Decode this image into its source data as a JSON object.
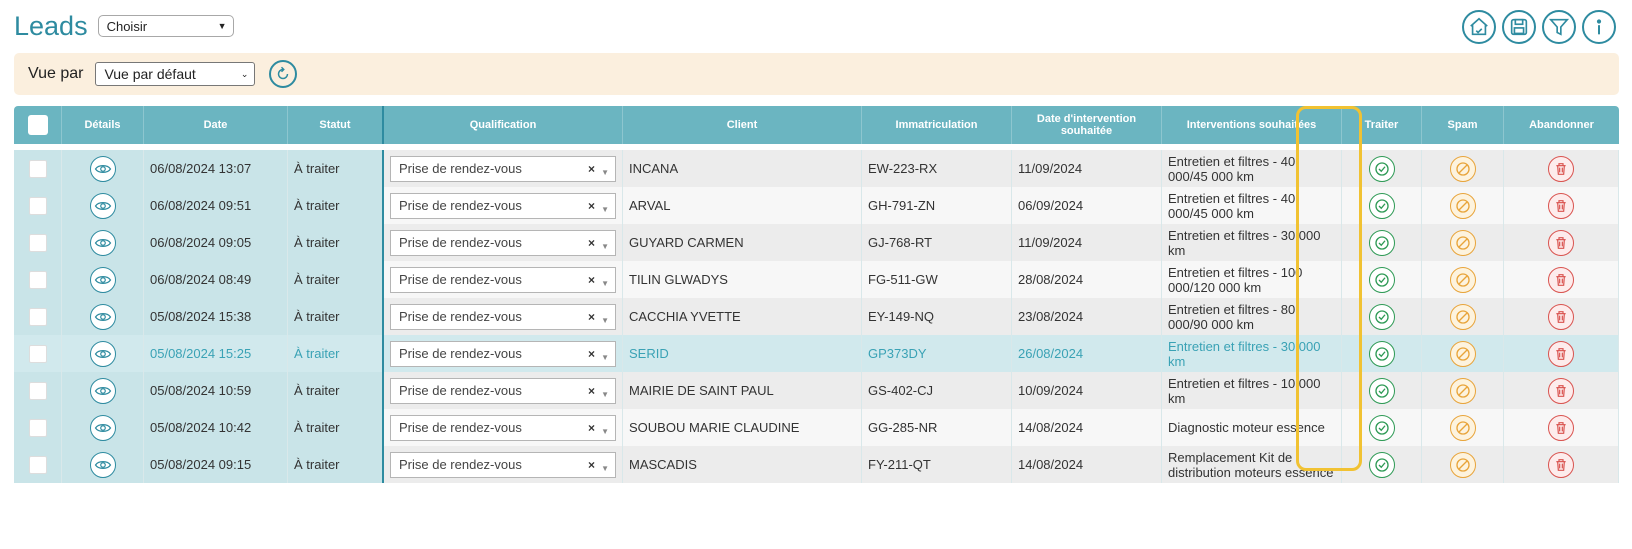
{
  "header": {
    "title": "Leads",
    "choose_select": "Choisir"
  },
  "top_icons": [
    "home-icon",
    "save-icon",
    "filter-icon",
    "info-icon"
  ],
  "view_bar": {
    "label": "Vue par",
    "select_value": "Vue par défaut"
  },
  "table": {
    "columns": {
      "details": "Détails",
      "date": "Date",
      "statut": "Statut",
      "qualification": "Qualification",
      "client": "Client",
      "immatriculation": "Immatriculation",
      "date_intervention": "Date d'intervention souhaitée",
      "interventions": "Interventions souhaitées",
      "traiter": "Traiter",
      "spam": "Spam",
      "abandonner": "Abandonner"
    },
    "rows": [
      {
        "date": "06/08/2024 13:07",
        "statut": "À traiter",
        "qualification": "Prise de rendez-vous",
        "client": "INCANA",
        "immat": "EW-223-RX",
        "date_int": "11/09/2024",
        "interventions": "Entretien et filtres - 40 000/45 000 km"
      },
      {
        "date": "06/08/2024 09:51",
        "statut": "À traiter",
        "qualification": "Prise de rendez-vous",
        "client": "ARVAL",
        "immat": "GH-791-ZN",
        "date_int": "06/09/2024",
        "interventions": "Entretien et filtres - 40 000/45 000 km"
      },
      {
        "date": "06/08/2024 09:05",
        "statut": "À traiter",
        "qualification": "Prise de rendez-vous",
        "client": "GUYARD CARMEN",
        "immat": "GJ-768-RT",
        "date_int": "11/09/2024",
        "interventions": "Entretien et filtres - 30 000 km"
      },
      {
        "date": "06/08/2024 08:49",
        "statut": "À traiter",
        "qualification": "Prise de rendez-vous",
        "client": "TILIN GLWADYS",
        "immat": "FG-511-GW",
        "date_int": "28/08/2024",
        "interventions": "Entretien et filtres - 100 000/120 000 km"
      },
      {
        "date": "05/08/2024 15:38",
        "statut": "À traiter",
        "qualification": "Prise de rendez-vous",
        "client": "CACCHIA YVETTE",
        "immat": "EY-149-NQ",
        "date_int": "23/08/2024",
        "interventions": "Entretien et filtres - 80 000/90 000 km"
      },
      {
        "date": "05/08/2024 15:25",
        "statut": "À traiter",
        "qualification": "Prise de rendez-vous",
        "client": "SERID",
        "immat": "GP373DY",
        "date_int": "26/08/2024",
        "interventions": "Entretien et filtres - 30 000 km"
      },
      {
        "date": "05/08/2024 10:59",
        "statut": "À traiter",
        "qualification": "Prise de rendez-vous",
        "client": "MAIRIE DE SAINT PAUL",
        "immat": "GS-402-CJ",
        "date_int": "10/09/2024",
        "interventions": "Entretien et filtres - 10 000 km"
      },
      {
        "date": "05/08/2024 10:42",
        "statut": "À traiter",
        "qualification": "Prise de rendez-vous",
        "client": "SOUBOU MARIE CLAUDINE",
        "immat": "GG-285-NR",
        "date_int": "14/08/2024",
        "interventions": "Diagnostic moteur essence"
      },
      {
        "date": "05/08/2024 09:15",
        "statut": "À traiter",
        "qualification": "Prise de rendez-vous",
        "client": "MASCADIS",
        "immat": "FY-211-QT",
        "date_int": "14/08/2024",
        "interventions": "Remplacement Kit de distribution moteurs essence"
      }
    ],
    "highlighted_row_index": 5
  },
  "colors": {
    "accent": "#2e8ba0",
    "header_bg": "#6bb5c1",
    "view_bar_bg": "#fbefde",
    "traiter_green": "#2e9a55",
    "spam_orange": "#e8a43a",
    "abandon_red": "#d9534f",
    "highlight_frame": "#f1c232"
  }
}
